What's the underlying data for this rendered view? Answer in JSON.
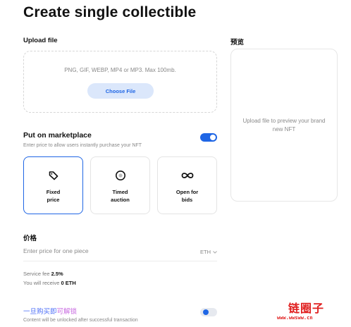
{
  "page": {
    "title": "Create single collectible"
  },
  "upload": {
    "label": "Upload file",
    "hint": "PNG, GIF, WEBP, MP4 or MP3. Max 100mb.",
    "button_label": "Choose File"
  },
  "preview": {
    "label": "预览",
    "placeholder": "Upload file to preview your brand new NFT"
  },
  "marketplace": {
    "title": "Put on marketplace",
    "subtitle": "Enter price to allow users instantly purchase your NFT",
    "toggle_on": true,
    "options": [
      {
        "label": "Fixed\nprice",
        "icon": "tag-icon",
        "selected": true
      },
      {
        "label": "Timed\nauction",
        "icon": "timer-icon",
        "selected": false
      },
      {
        "label": "Open for\nbids",
        "icon": "infinity-icon",
        "selected": false
      }
    ]
  },
  "price": {
    "label": "价格",
    "placeholder": "Enter price for one piece",
    "currency": "ETH"
  },
  "fees": {
    "service_fee_label": "Service fee",
    "service_fee_value": "2.5%",
    "receive_label": "You will receive",
    "receive_value": "0 ETH"
  },
  "unlock": {
    "title_part1": "一旦购买即",
    "title_part2": "可解锁",
    "subtitle": "Content will be unlocked after successful transaction",
    "toggle_on": false
  },
  "watermark": {
    "logo": "链圈子",
    "url": "www.wwsww.cn"
  },
  "colors": {
    "accent": "#1f66e5",
    "accent_light": "#dbe7fb",
    "watermark": "#e02020"
  }
}
